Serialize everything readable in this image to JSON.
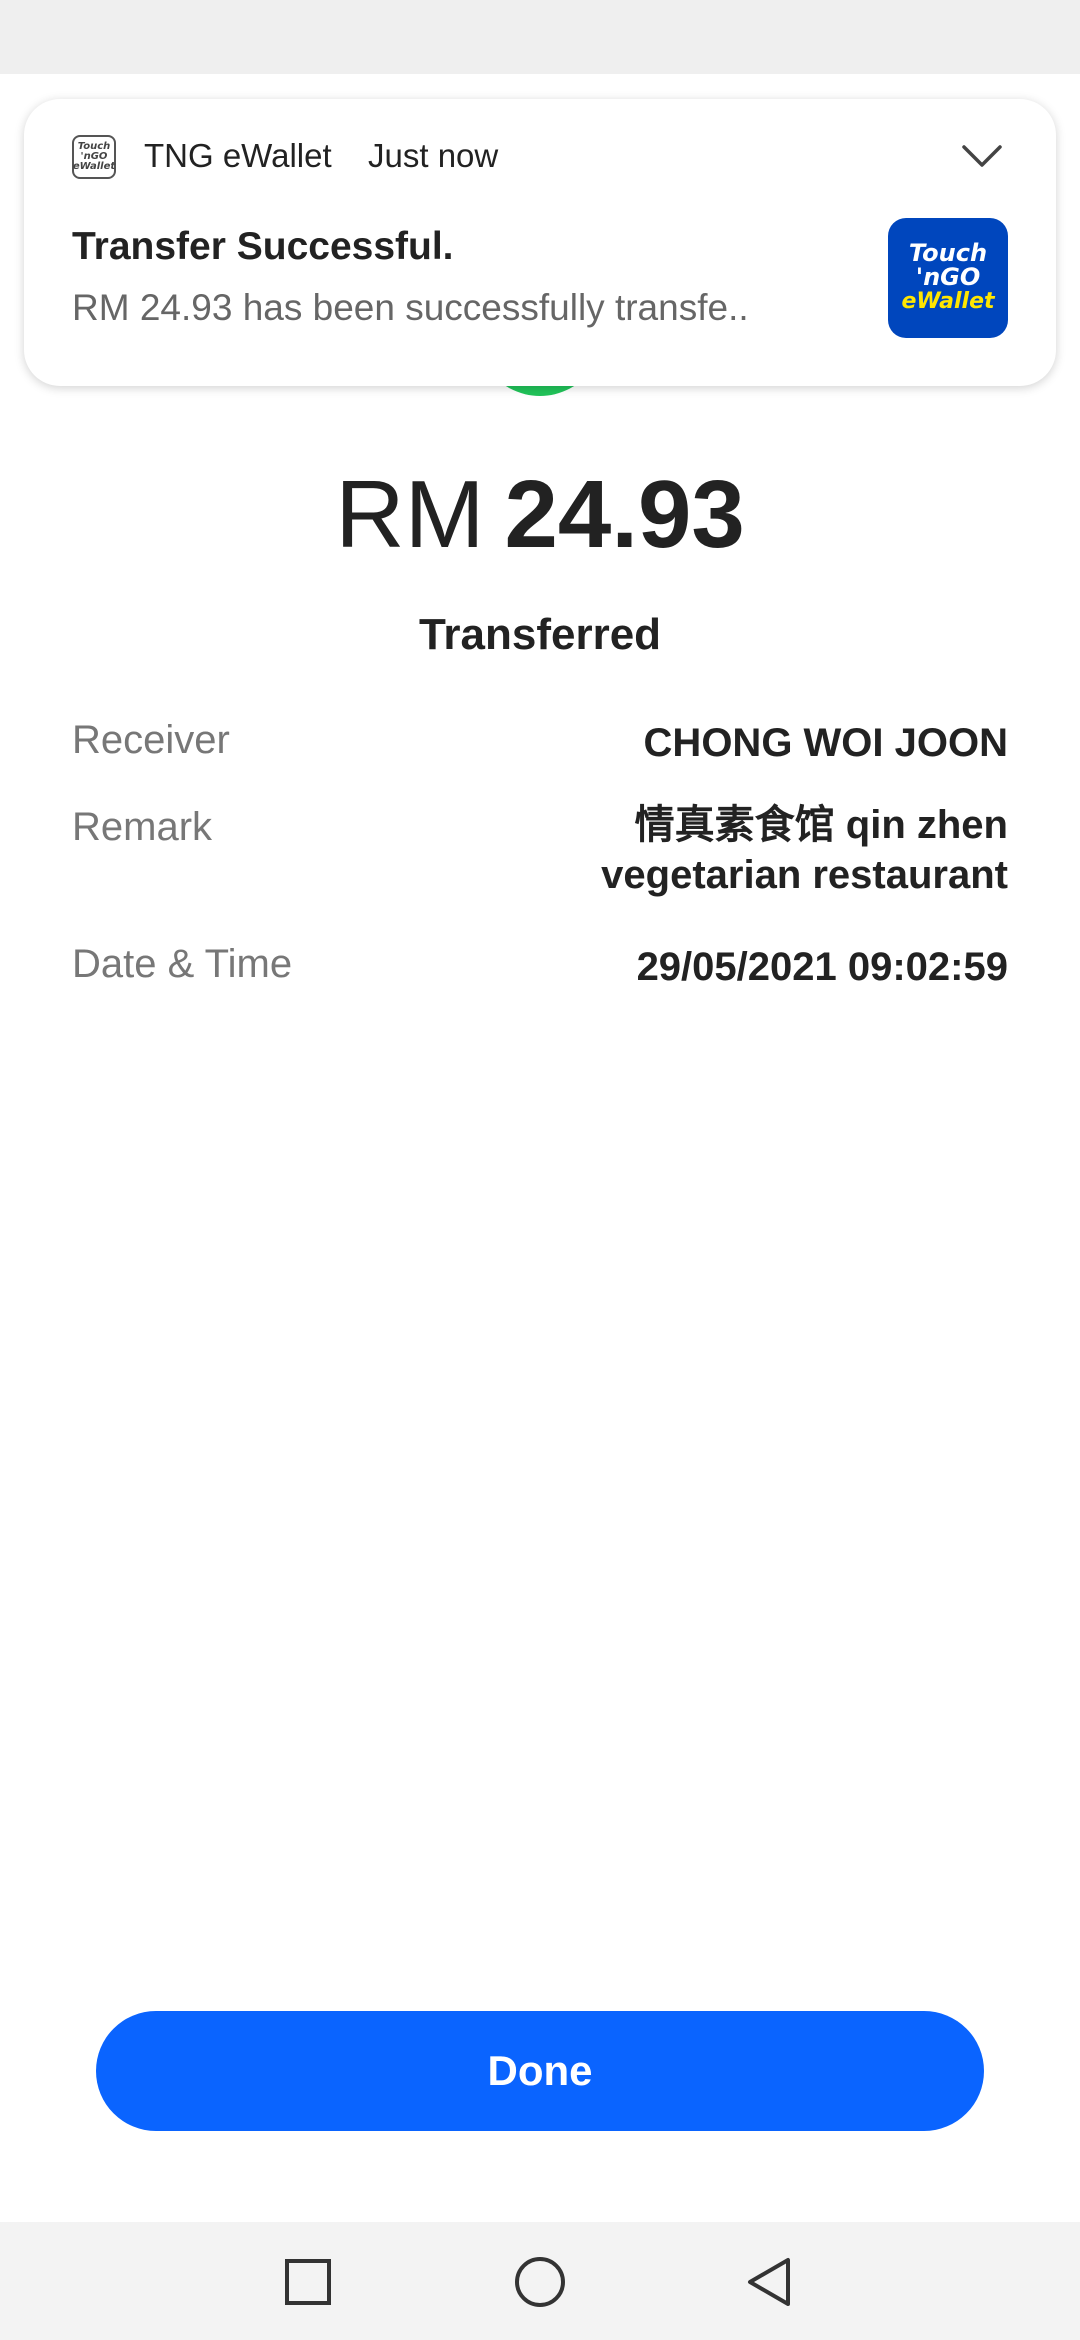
{
  "notification": {
    "app_name": "TNG eWallet",
    "time": "Just now",
    "title": "Transfer Successful.",
    "body": "RM 24.93 has been successfully transfe..",
    "small_icon_text": [
      "Touch",
      "'nGO",
      "eWallet"
    ],
    "logo_lines": [
      "Touch",
      "'nGO",
      "eWallet"
    ],
    "icon": "chevron-down-icon"
  },
  "receipt": {
    "currency": "RM",
    "amount": "24.93",
    "status": "Transferred",
    "rows": [
      {
        "label": "Receiver",
        "value": "CHONG WOI JOON"
      },
      {
        "label": "Remark",
        "value_line1": "情真素食馆 qin zhen",
        "value_line2": "vegetarian restaurant"
      },
      {
        "label": "Date & Time",
        "value": "29/05/2021 09:02:59"
      }
    ]
  },
  "actions": {
    "done_label": "Done"
  },
  "colors": {
    "success_green": "#21c45a",
    "primary_blue": "#0a64ff",
    "tng_blue": "#0046bd",
    "tng_yellow": "#ffe600"
  },
  "nav_icons": [
    "recents-square-icon",
    "home-circle-icon",
    "back-triangle-icon"
  ]
}
